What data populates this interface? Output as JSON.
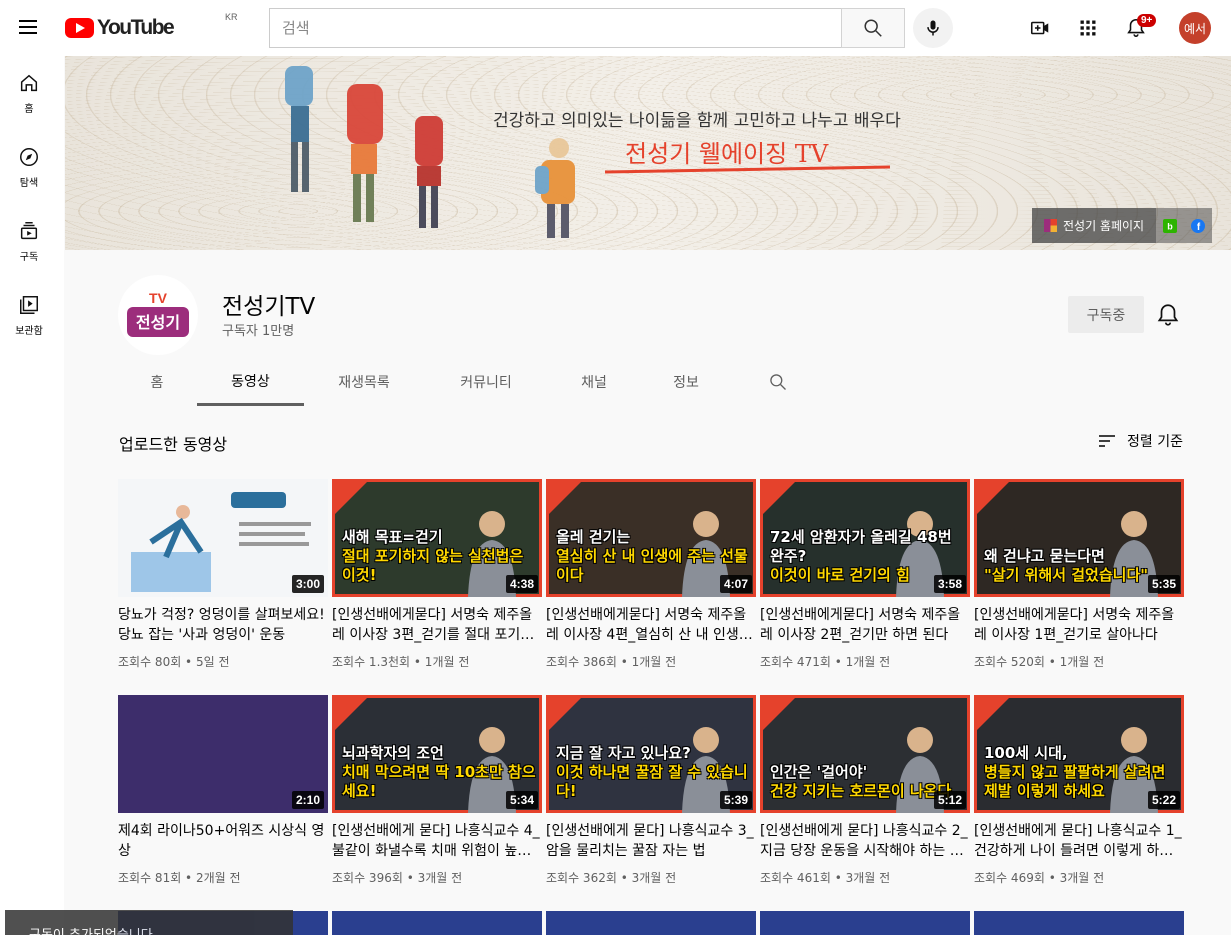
{
  "header": {
    "logo_text": "YouTube",
    "region": "KR",
    "search_placeholder": "검색",
    "notifications_badge": "9+",
    "avatar_text": "예서"
  },
  "guide": [
    {
      "label": "홈",
      "icon": "home-icon"
    },
    {
      "label": "탐색",
      "icon": "compass-icon"
    },
    {
      "label": "구독",
      "icon": "subscriptions-icon"
    },
    {
      "label": "보관함",
      "icon": "library-icon"
    }
  ],
  "banner": {
    "tagline": "건강하고 의미있는 나이듦을 함께 고민하고 나누고 배우다",
    "title": "전성기 웰에이징 TV",
    "homepage_link": "전성기 홈페이지"
  },
  "channel": {
    "name": "전성기TV",
    "subscribers": "구독자 1만명",
    "subscribe_label": "구독중",
    "avatar_text": "TV 전성기"
  },
  "tabs": [
    "홈",
    "동영상",
    "재생목록",
    "커뮤니티",
    "채널",
    "정보"
  ],
  "content": {
    "section_title": "업로드한 동영상",
    "sort_label": "정렬 기준"
  },
  "videos": [
    {
      "title": "당뇨가 걱정? 엉덩이를 살펴보세요! 당뇨 잡는 '사과 엉덩이' 운동",
      "meta": "조회수 80회 • 5일 전",
      "duration": "3:00",
      "thumb_text": "",
      "thumb_hl": ""
    },
    {
      "title": "[인생선배에게묻다] 서명숙 제주올레 이사장 3편_걷기를 절대 포기하지 않는 실천법",
      "meta": "조회수 1.3천회 • 1개월 전",
      "duration": "4:38",
      "thumb_text": "새해 목표=걷기",
      "thumb_hl": "절대 포기하지 않는 실천법은 이것!"
    },
    {
      "title": "[인생선배에게묻다] 서명숙 제주올레 이사장 4편_열심히 산 내 인생에 주는 선물",
      "meta": "조회수 386회 • 1개월 전",
      "duration": "4:07",
      "thumb_text": "올레 걷기는",
      "thumb_hl": "열심히 산 내 인생에 주는 선물이다"
    },
    {
      "title": "[인생선배에게묻다] 서명숙 제주올레 이사장 2편_걷기만 하면 된다",
      "meta": "조회수 471회 • 1개월 전",
      "duration": "3:58",
      "thumb_text": "72세 암환자가 올레길 48번 완주?",
      "thumb_hl": "이것이 바로 걷기의 힘"
    },
    {
      "title": "[인생선배에게묻다] 서명숙 제주올레 이사장 1편_걷기로 살아나다",
      "meta": "조회수 520회 • 1개월 전",
      "duration": "5:35",
      "thumb_text": "왜 걷냐고 묻는다면",
      "thumb_hl": "\"살기 위해서 걸었습니다\""
    },
    {
      "title": "제4회 라이나50+어워즈 시상식 영상",
      "meta": "조회수 81회 • 2개월 전",
      "duration": "2:10",
      "thumb_text": "",
      "thumb_hl": ""
    },
    {
      "title": "[인생선배에게 묻다] 나흥식교수 4_ 불같이 화낼수록 치매 위험이 높아진다",
      "meta": "조회수 396회 • 3개월 전",
      "duration": "5:34",
      "thumb_text": "뇌과학자의 조언",
      "thumb_hl": "치매 막으려면 딱 10초만 참으세요!"
    },
    {
      "title": "[인생선배에게 묻다] 나흥식교수 3_ 암을 물리치는 꿀잠 자는 법",
      "meta": "조회수 362회 • 3개월 전",
      "duration": "5:39",
      "thumb_text": "지금 잘 자고 있나요?",
      "thumb_hl": "이것 하나면 꿀잠 잘 수 있습니다!"
    },
    {
      "title": "[인생선배에게 묻다] 나흥식교수 2_지금 당장 운동을 시작해야 하는 이유",
      "meta": "조회수 461회 • 3개월 전",
      "duration": "5:12",
      "thumb_text": "인간은 '걸어야'",
      "thumb_hl": "건강 지키는 호르몬이 나온다"
    },
    {
      "title": "[인생선배에게 묻다] 나흥식교수 1_ 건강하게 나이 들려면 이렇게 하세요",
      "meta": "조회수 469회 • 3개월 전",
      "duration": "5:22",
      "thumb_text": "100세 시대,",
      "thumb_hl": "병들지 않고 팔팔하게 살려면 제발 이렇게 하세요"
    }
  ],
  "toast": "구독이 추가되었습니다.",
  "colors": {
    "accent": "#ff0000",
    "brand_red": "#e5422c",
    "badge": "#cc0000"
  }
}
